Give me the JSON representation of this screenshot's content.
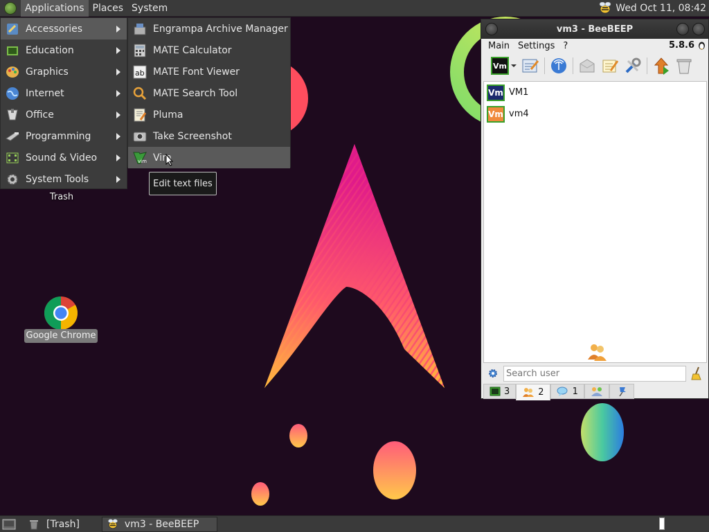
{
  "top_panel": {
    "menus": [
      "Applications",
      "Places",
      "System"
    ],
    "clock": "Wed Oct 11, 08:42"
  },
  "app_menu": {
    "categories": [
      {
        "label": "Accessories",
        "icon": "accessories-icon"
      },
      {
        "label": "Education",
        "icon": "education-icon"
      },
      {
        "label": "Graphics",
        "icon": "graphics-icon"
      },
      {
        "label": "Internet",
        "icon": "internet-icon"
      },
      {
        "label": "Office",
        "icon": "office-icon"
      },
      {
        "label": "Programming",
        "icon": "programming-icon"
      },
      {
        "label": "Sound & Video",
        "icon": "sound-video-icon"
      },
      {
        "label": "System Tools",
        "icon": "system-tools-icon"
      }
    ],
    "accessories": [
      {
        "label": "Engrampa Archive Manager",
        "icon": "archive-manager-icon"
      },
      {
        "label": "MATE Calculator",
        "icon": "calculator-icon"
      },
      {
        "label": "MATE Font Viewer",
        "icon": "font-viewer-icon"
      },
      {
        "label": "MATE Search Tool",
        "icon": "search-tool-icon"
      },
      {
        "label": "Pluma",
        "icon": "pluma-icon"
      },
      {
        "label": "Take Screenshot",
        "icon": "screenshot-icon"
      },
      {
        "label": "Vim",
        "icon": "vim-icon"
      }
    ],
    "tooltip": "Edit text files"
  },
  "desktop": {
    "trash_label": "Trash",
    "chrome_label": "Google Chrome"
  },
  "beebeep": {
    "title": "vm3 - BeeBEEP",
    "menu": [
      "Main",
      "Settings",
      "?"
    ],
    "version": "5.8.6",
    "users": [
      {
        "badge": "Vm",
        "name": "VM1",
        "color": "#1a2a6e"
      },
      {
        "badge": "Vm",
        "name": "vm4",
        "color": "#f08a3c"
      }
    ],
    "search_placeholder": "Search user",
    "tabs": [
      {
        "icon": "chat-list-icon",
        "count": "3"
      },
      {
        "icon": "users-icon",
        "count": "2"
      },
      {
        "icon": "messages-icon",
        "count": "1"
      },
      {
        "icon": "groups-icon",
        "count": ""
      },
      {
        "icon": "pin-icon",
        "count": ""
      }
    ]
  },
  "bottom_panel": {
    "tasks": [
      "[Trash]",
      "vm3 - BeeBEEP"
    ]
  },
  "colors": {
    "panel": "#3a3a3a",
    "menu": "#3c3c3c",
    "menu_selected": "#5a5a5a",
    "wallpaper": "#1e0a1e"
  }
}
